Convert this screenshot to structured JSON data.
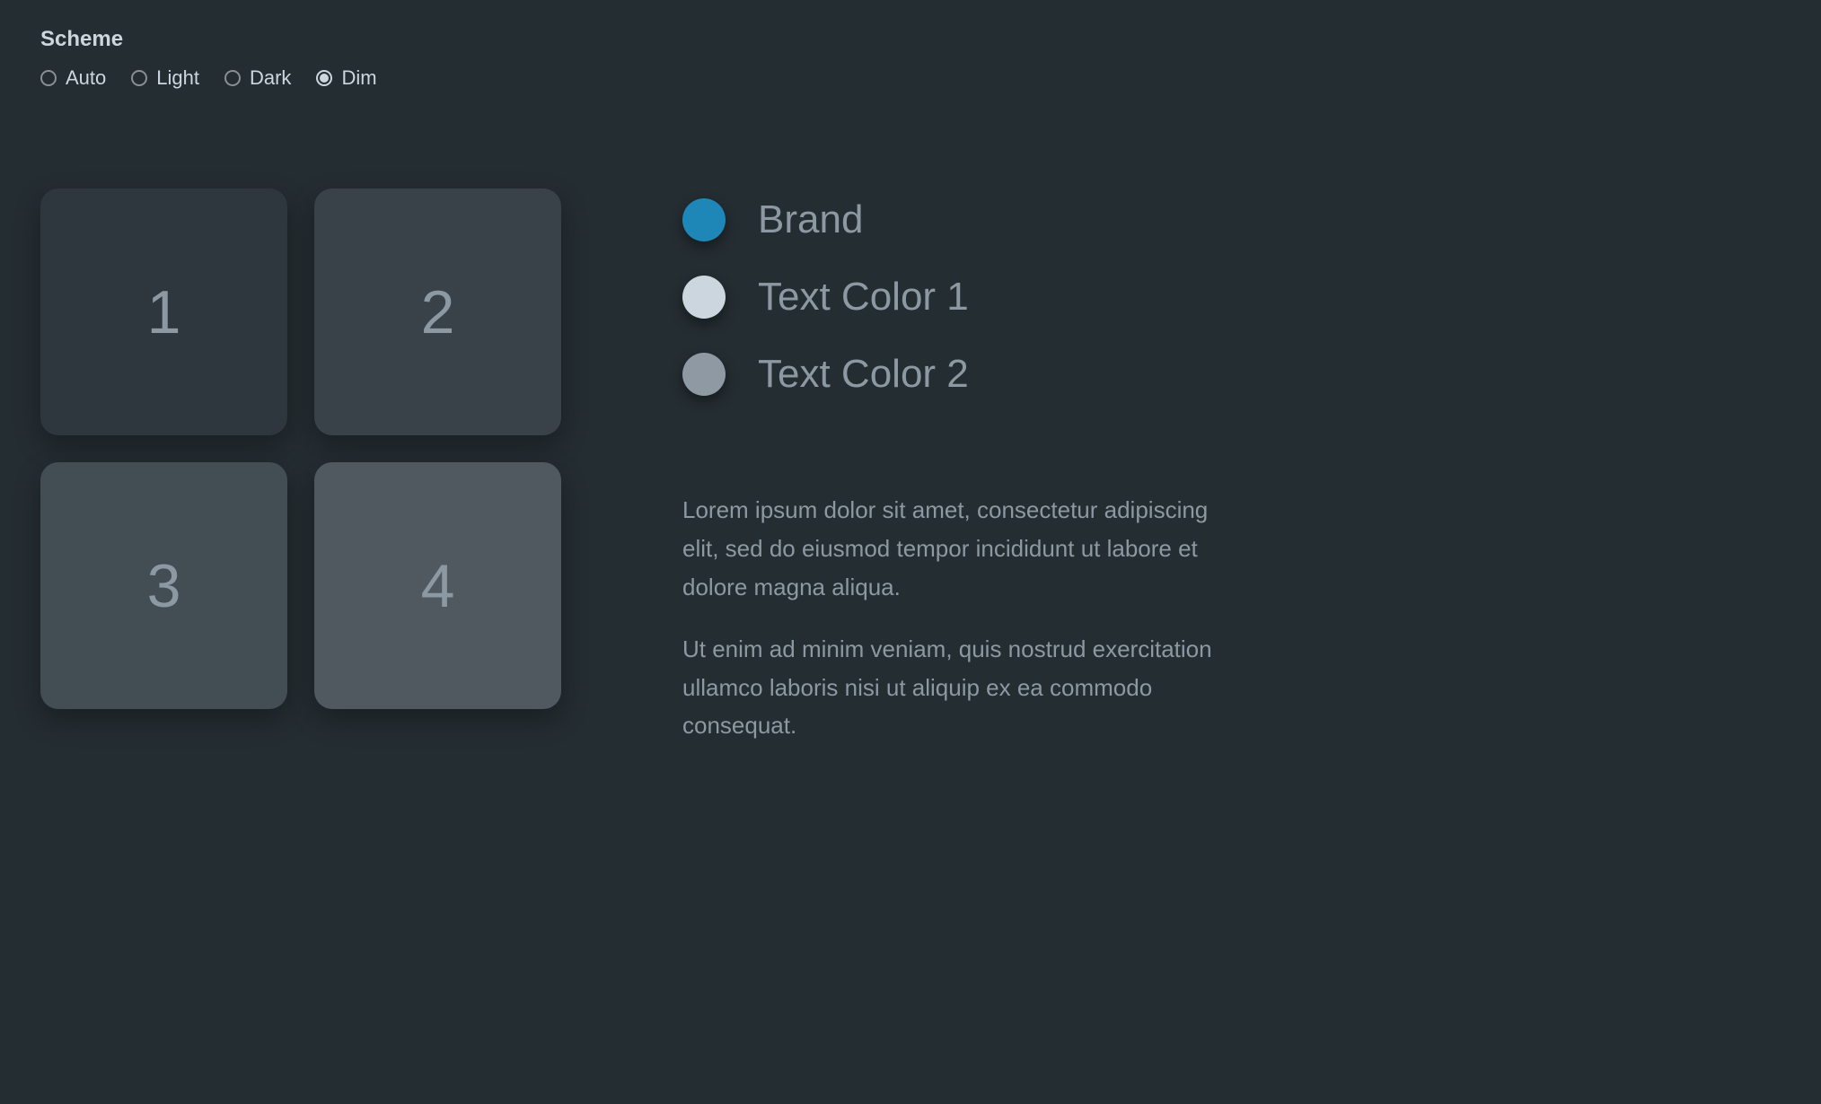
{
  "scheme": {
    "label": "Scheme",
    "options": [
      {
        "label": "Auto",
        "selected": false
      },
      {
        "label": "Light",
        "selected": false
      },
      {
        "label": "Dark",
        "selected": false
      },
      {
        "label": "Dim",
        "selected": true
      }
    ]
  },
  "tiles": [
    {
      "label": "1"
    },
    {
      "label": "2"
    },
    {
      "label": "3"
    },
    {
      "label": "4"
    }
  ],
  "swatches": [
    {
      "label": "Brand",
      "color": "#1e87b8"
    },
    {
      "label": "Text Color 1",
      "color": "#cbd6de"
    },
    {
      "label": "Text Color 2",
      "color": "#8f99a3"
    }
  ],
  "paragraphs": [
    "Lorem ipsum dolor sit amet, consectetur adipiscing elit, sed do eiusmod tempor incididunt ut labore et dolore magna aliqua.",
    "Ut enim ad minim veniam, quis nostrud exercitation ullamco laboris nisi ut aliquip ex ea commodo consequat."
  ]
}
